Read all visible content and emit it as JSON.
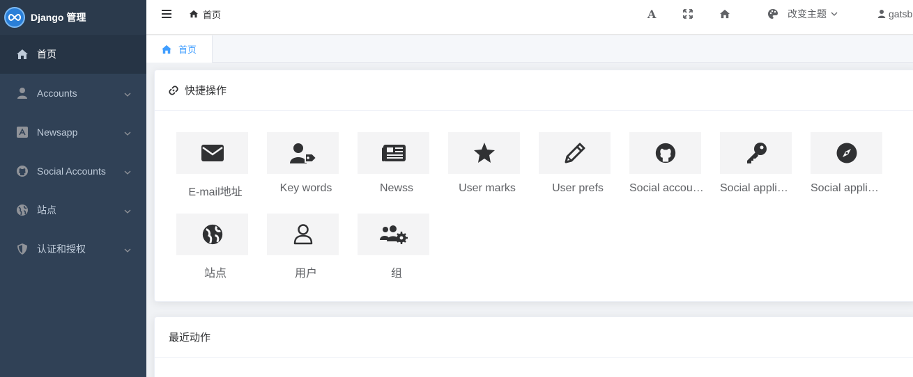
{
  "brand": {
    "title": "Django 管理"
  },
  "sidebar": {
    "items": [
      {
        "label": "首页",
        "icon": "home-icon"
      },
      {
        "label": "Accounts",
        "icon": "user-icon"
      },
      {
        "label": "Newsapp",
        "icon": "app-icon"
      },
      {
        "label": "Social Accounts",
        "icon": "github-icon"
      },
      {
        "label": "站点",
        "icon": "globe-icon"
      },
      {
        "label": "认证和授权",
        "icon": "shield-icon"
      }
    ]
  },
  "topbar": {
    "breadcrumb": "首页",
    "theme_label": "改变主题",
    "user": "gatsb"
  },
  "tabs": [
    {
      "label": "首页"
    }
  ],
  "quick": {
    "title": "快捷操作",
    "items": [
      {
        "label": "E-mail地址",
        "icon": "envelope-icon"
      },
      {
        "label": "Key words",
        "icon": "user-tag-icon"
      },
      {
        "label": "Newss",
        "icon": "newspaper-icon"
      },
      {
        "label": "User marks",
        "icon": "star-icon"
      },
      {
        "label": "User prefs",
        "icon": "pencil-icon"
      },
      {
        "label": "Social accou…",
        "icon": "github-icon"
      },
      {
        "label": "Social appli…",
        "icon": "key-icon"
      },
      {
        "label": "Social appli…",
        "icon": "compass-icon"
      },
      {
        "label": "站点",
        "icon": "globe-icon"
      },
      {
        "label": "用户",
        "icon": "user-outline-icon"
      },
      {
        "label": "组",
        "icon": "users-cog-icon"
      }
    ]
  },
  "recent": {
    "title": "最近动作"
  },
  "colors": {
    "sidebar_bg": "#304156",
    "sidebar_active": "#263445",
    "accent": "#409eff"
  }
}
